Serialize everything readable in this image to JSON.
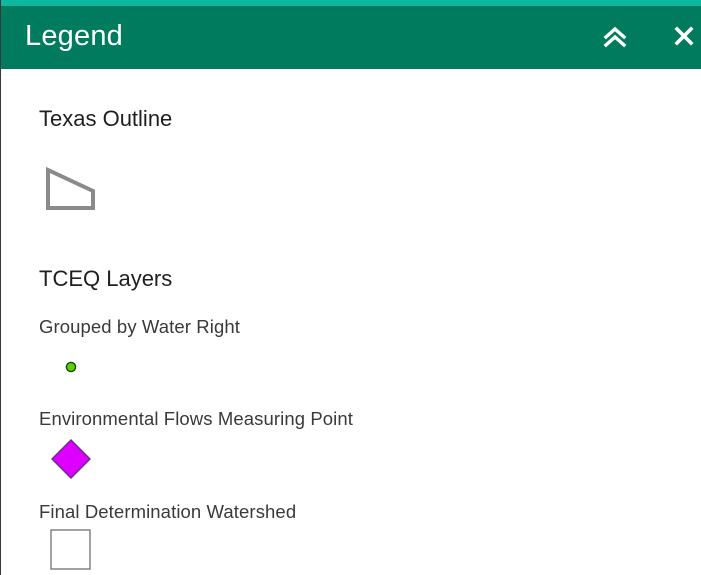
{
  "header": {
    "title": "Legend",
    "background_color": "#017b5d",
    "accent_color": "#10b7a0",
    "collapse_icon": "double-chevron-up-icon",
    "close_icon": "close-icon"
  },
  "layers": [
    {
      "title": "Texas Outline",
      "symbols": [
        {
          "label": "",
          "icon": "polygon-outline-icon",
          "stroke_color": "#8a8a8a"
        }
      ]
    },
    {
      "title": "TCEQ Layers",
      "symbols": [
        {
          "label": "Grouped by Water Right",
          "icon": "green-point-icon",
          "fill_color": "#5cd000",
          "stroke_color": "#1a4a10"
        },
        {
          "label": "Environmental Flows Measuring Point",
          "icon": "magenta-diamond-icon",
          "fill_color": "#dd00ff",
          "stroke_color": "#6a2a8a"
        },
        {
          "label": "Final Determination Watershed",
          "icon": "empty-square-icon",
          "fill_color": "#ffffff",
          "stroke_color": "#7a7a7a"
        }
      ]
    }
  ]
}
